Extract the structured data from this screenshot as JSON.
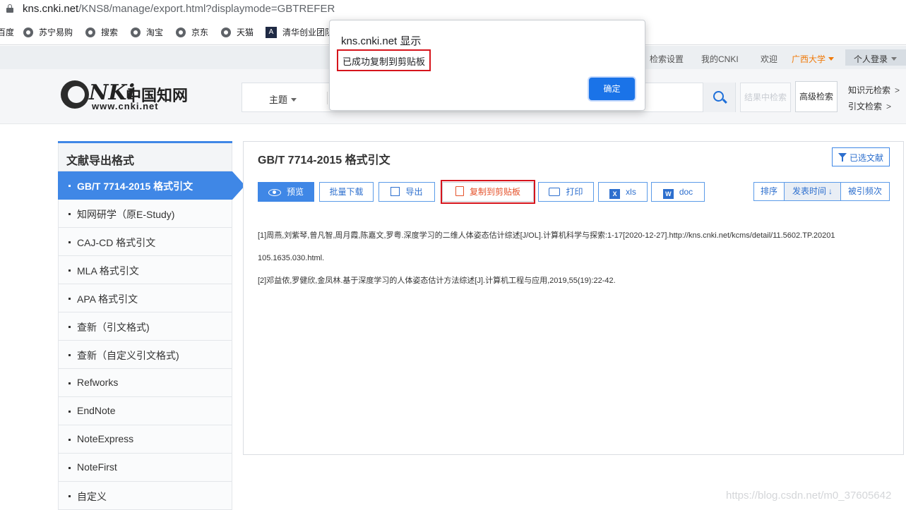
{
  "browser": {
    "url_host": "kns.cnki.net",
    "url_path": "/KNS8/manage/export.html?displaymode=GBTREFER",
    "bookmarks": [
      {
        "label": "百度",
        "icon": "none"
      },
      {
        "label": "苏宁易购",
        "icon": "globe-icon"
      },
      {
        "label": "搜索",
        "icon": "globe-icon"
      },
      {
        "label": "淘宝",
        "icon": "globe-icon"
      },
      {
        "label": "京东",
        "icon": "globe-icon"
      },
      {
        "label": "天猫",
        "icon": "globe-icon"
      },
      {
        "label": "清华创业团队",
        "icon": "logo-icon"
      }
    ]
  },
  "topbar": {
    "search_settings": "检索设置",
    "my_cnki": "我的CNKI",
    "welcome": "欢迎",
    "institution": "广西大学",
    "login": "个人登录"
  },
  "header": {
    "logo_text": "CNKI",
    "logo_cn": "中国知网",
    "logo_url": "www.cnki.net",
    "field_select": "主题",
    "in_results": "结果中检索",
    "advanced": "高级检索",
    "knowledge_search": "知识元检索",
    "citation_search": "引文检索",
    "arrow": ">"
  },
  "sidebar": {
    "title": "文献导出格式",
    "items": [
      {
        "label": "GB/T 7714-2015 格式引文",
        "active": true
      },
      {
        "label": "知网研学（原E-Study)"
      },
      {
        "label": "CAJ-CD 格式引文"
      },
      {
        "label": "MLA 格式引文"
      },
      {
        "label": "APA 格式引文"
      },
      {
        "label": "查新（引文格式)"
      },
      {
        "label": "查新（自定义引文格式)"
      },
      {
        "label": "Refworks"
      },
      {
        "label": "EndNote"
      },
      {
        "label": "NoteExpress"
      },
      {
        "label": "NoteFirst"
      },
      {
        "label": "自定义"
      }
    ]
  },
  "panel": {
    "title": "GB/T 7714-2015 格式引文",
    "selected_docs": "已选文献",
    "toolbar": {
      "preview": "预览",
      "batch_download": "批量下载",
      "export": "导出",
      "copy": "复制到剪贴板",
      "print": "打印",
      "xls": "xls",
      "doc": "doc"
    },
    "sort": {
      "label": "排序",
      "by_date": "发表时间",
      "by_cited": "被引频次",
      "arrow": "↓"
    },
    "references": [
      "[1]周燕,刘紫琴,曾凡智,周月霞,陈嘉文,罗粤.深度学习的二维人体姿态估计综述[J/OL].计算机科学与探索:1-17[2020-12-27].http://kns.cnki.net/kcms/detail/11.5602.TP.20201",
      "105.1635.030.html.",
      "[2]邓益侬,罗健欣,金凤林.基于深度学习的人体姿态估计方法综述[J].计算机工程与应用,2019,55(19):22-42."
    ]
  },
  "dialog": {
    "title": "kns.cnki.net 显示",
    "message": "已成功复制到剪贴板",
    "ok": "确定"
  },
  "watermark": "https://blog.csdn.net/m0_37605642",
  "colors": {
    "accent": "#3f87e6",
    "highlight": "#d6141c",
    "copy_text": "#e5522b",
    "institution": "#f07a0a"
  }
}
